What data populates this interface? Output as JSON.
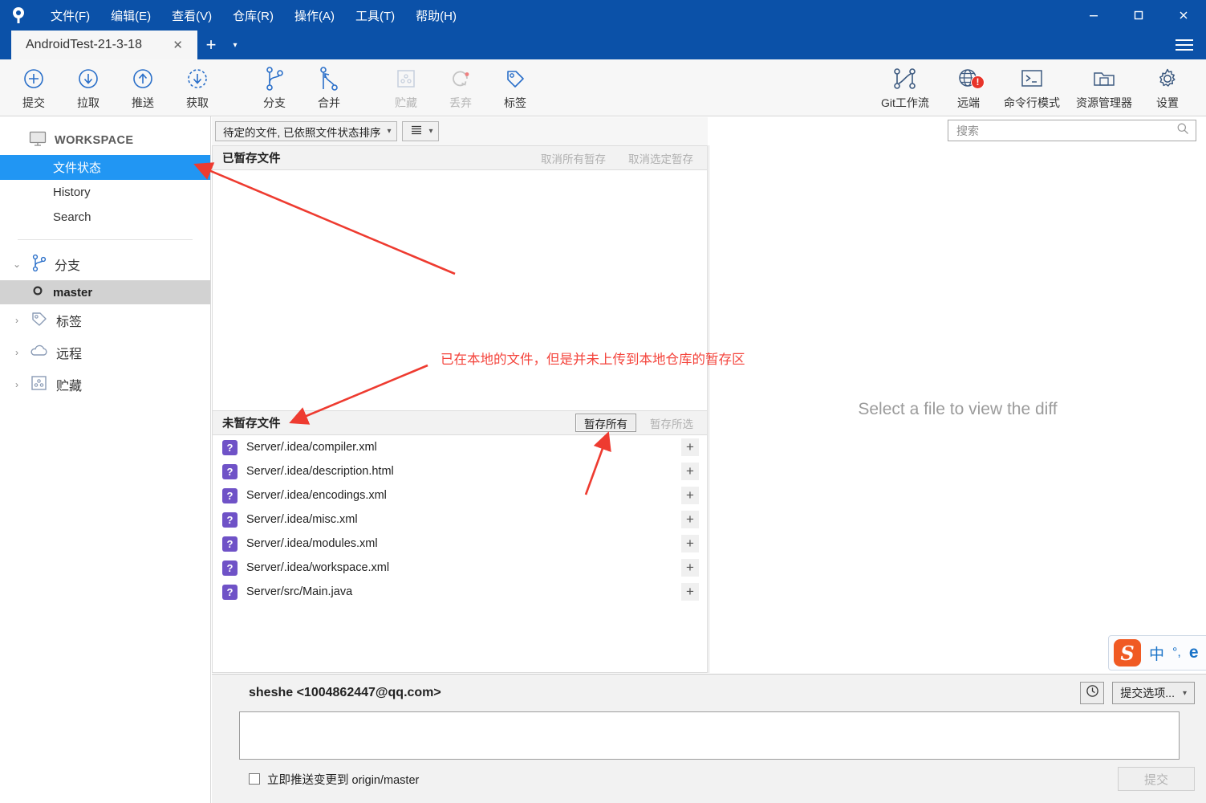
{
  "window": {
    "app_icon": "sourcetree-logo-icon",
    "menus": [
      {
        "label": "文件(F)"
      },
      {
        "label": "编辑(E)"
      },
      {
        "label": "查看(V)"
      },
      {
        "label": "仓库(R)"
      },
      {
        "label": "操作(A)"
      },
      {
        "label": "工具(T)"
      },
      {
        "label": "帮助(H)"
      }
    ],
    "controls": {
      "minimize": "—",
      "maximize": "☐",
      "close": "✕"
    },
    "titlebar_color": "#0b51a8"
  },
  "tabbar": {
    "tab_title": "AndroidTest-21-3-18",
    "close_label": "✕",
    "add_label": "+",
    "add_caret": "▾"
  },
  "toolbar": {
    "left": [
      {
        "label": "提交",
        "icon": "commit-plus-circle-icon",
        "disabled": false
      },
      {
        "label": "拉取",
        "icon": "pull-down-arrow-circle-icon",
        "disabled": false
      },
      {
        "label": "推送",
        "icon": "push-up-arrow-circle-icon",
        "disabled": false
      },
      {
        "label": "获取",
        "icon": "fetch-dashed-circle-icon",
        "disabled": false
      },
      {
        "label": "分支",
        "icon": "branch-icon",
        "disabled": false
      },
      {
        "label": "合并",
        "icon": "merge-icon",
        "disabled": false
      },
      {
        "label": "贮藏",
        "icon": "stash-box-icon",
        "disabled": true
      },
      {
        "label": "丢弃",
        "icon": "discard-revert-icon",
        "disabled": true
      },
      {
        "label": "标签",
        "icon": "tag-icon",
        "disabled": false
      }
    ],
    "right": [
      {
        "label": "Git工作流",
        "icon": "git-flow-icon",
        "badge": ""
      },
      {
        "label": "远端",
        "icon": "remote-globe-icon",
        "badge": "!"
      },
      {
        "label": "命令行模式",
        "icon": "terminal-icon",
        "badge": ""
      },
      {
        "label": "资源管理器",
        "icon": "explorer-folder-icon",
        "badge": ""
      },
      {
        "label": "设置",
        "icon": "gear-settings-icon",
        "badge": ""
      }
    ]
  },
  "sidebar": {
    "workspace_label": "WORKSPACE",
    "workspace_icon": "monitor-icon",
    "items": [
      {
        "label": "文件状态",
        "selected": true
      },
      {
        "label": "History",
        "selected": false
      },
      {
        "label": "Search",
        "selected": false
      }
    ],
    "groups": [
      {
        "label": "分支",
        "icon": "branch-icon",
        "expanded": true,
        "caret": "⌄"
      },
      {
        "label": "标签",
        "icon": "tag-icon",
        "expanded": false,
        "caret": "›"
      },
      {
        "label": "远程",
        "icon": "cloud-icon",
        "expanded": false,
        "caret": "›"
      },
      {
        "label": "贮藏",
        "icon": "stash-box-icon",
        "expanded": false,
        "caret": "›"
      }
    ],
    "branch": {
      "label": "master",
      "icon": "branch-node-circle-icon"
    }
  },
  "filterbar": {
    "sort_combo": "待定的文件, 已依照文件状态排序",
    "view_combo_icon": "list-view-icon"
  },
  "search": {
    "placeholder": "搜索",
    "value": "",
    "icon": "search-icon"
  },
  "staged": {
    "title": "已暂存文件",
    "buttons": [
      {
        "label": "取消所有暂存",
        "enabled": false
      },
      {
        "label": "取消选定暂存",
        "enabled": false
      }
    ],
    "files": []
  },
  "unstaged": {
    "title": "未暂存文件",
    "buttons": [
      {
        "label": "暂存所有",
        "enabled": true
      },
      {
        "label": "暂存所选",
        "enabled": false
      }
    ],
    "files": [
      {
        "status": "?",
        "path": "Server/.idea/compiler.xml",
        "action": "+"
      },
      {
        "status": "?",
        "path": "Server/.idea/description.html",
        "action": "+"
      },
      {
        "status": "?",
        "path": "Server/.idea/encodings.xml",
        "action": "+"
      },
      {
        "status": "?",
        "path": "Server/.idea/misc.xml",
        "action": "+"
      },
      {
        "status": "?",
        "path": "Server/.idea/modules.xml",
        "action": "+"
      },
      {
        "status": "?",
        "path": "Server/.idea/workspace.xml",
        "action": "+"
      },
      {
        "status": "?",
        "path": "Server/src/Main.java",
        "action": "+"
      }
    ],
    "status_color": "#6f52c7"
  },
  "diff": {
    "placeholder": "Select a file to view the diff"
  },
  "commit": {
    "author": "sheshe <1004862447@qq.com>",
    "history_icon": "clock-history-icon",
    "options_label": "提交选项...",
    "message_value": "",
    "push_checkbox_label": "立即推送变更到 origin/master",
    "push_checked": false,
    "commit_button": "提交",
    "commit_button_enabled": false
  },
  "annotations": {
    "note": "已在本地的文件，但是并未上传到本地仓库的暂存区",
    "color": "#f4443c"
  },
  "ime": {
    "logo": "S",
    "mode": "中",
    "punct": "°,",
    "extra": "e"
  }
}
